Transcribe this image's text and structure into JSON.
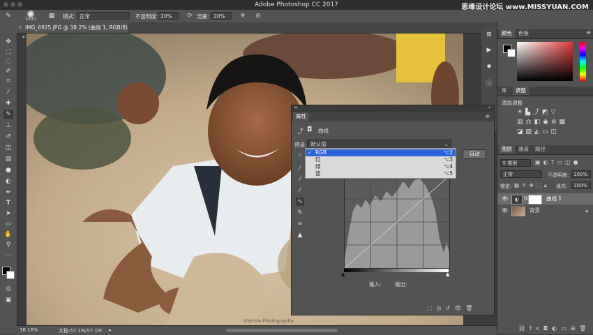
{
  "app": {
    "window_title": "Adobe Photoshop CC 2017",
    "watermark": "思缘设计论坛 www.MISSYUAN.COM"
  },
  "options_bar": {
    "brush_size": "1000",
    "mode_label": "模式:",
    "mode_value": "正常",
    "opacity_label": "不透明度:",
    "opacity_value": "20%",
    "flow_label": "流量:",
    "flow_value": "20%"
  },
  "document": {
    "tab_title": "IMG_6925.JPG @ 38.2% (曲线 1, RGB/8) *",
    "photo_watermark": "Vlahhlo Photography"
  },
  "status_bar": {
    "zoom": "38.16%",
    "doc_size": "文档:57.1M/57.1M"
  },
  "color_panel": {
    "tabs": [
      "颜色",
      "色板"
    ],
    "hue_color": "#e63a3a",
    "foreground": "#000000",
    "background": "#ffffff"
  },
  "adjustments_panel": {
    "tabs": [
      "库",
      "调整"
    ],
    "add_label": "添加调整"
  },
  "layers_panel": {
    "tabs": [
      "图层",
      "通道",
      "路径"
    ],
    "filter_kind": "类型",
    "blend_mode": "正常",
    "opacity_label": "不透明度:",
    "opacity_value": "100%",
    "lock_label": "锁定:",
    "fill_label": "填充:",
    "fill_value": "100%",
    "layers": [
      {
        "name": "曲线 1"
      },
      {
        "name": "背景"
      }
    ]
  },
  "properties_panel": {
    "title": "属性",
    "type_label": "曲线",
    "preset_label": "预设:",
    "preset_value": "默认值",
    "auto_label": "自动",
    "input_label": "输入:",
    "output_label": "输出:"
  },
  "channel_menu": {
    "items": [
      {
        "check": "✓",
        "name": "RGB",
        "shortcut": "⌥2"
      },
      {
        "check": "",
        "name": "红",
        "shortcut": "⌥3"
      },
      {
        "check": "",
        "name": "绿",
        "shortcut": "⌥4"
      },
      {
        "check": "",
        "name": "蓝",
        "shortcut": "⌥5"
      }
    ]
  }
}
